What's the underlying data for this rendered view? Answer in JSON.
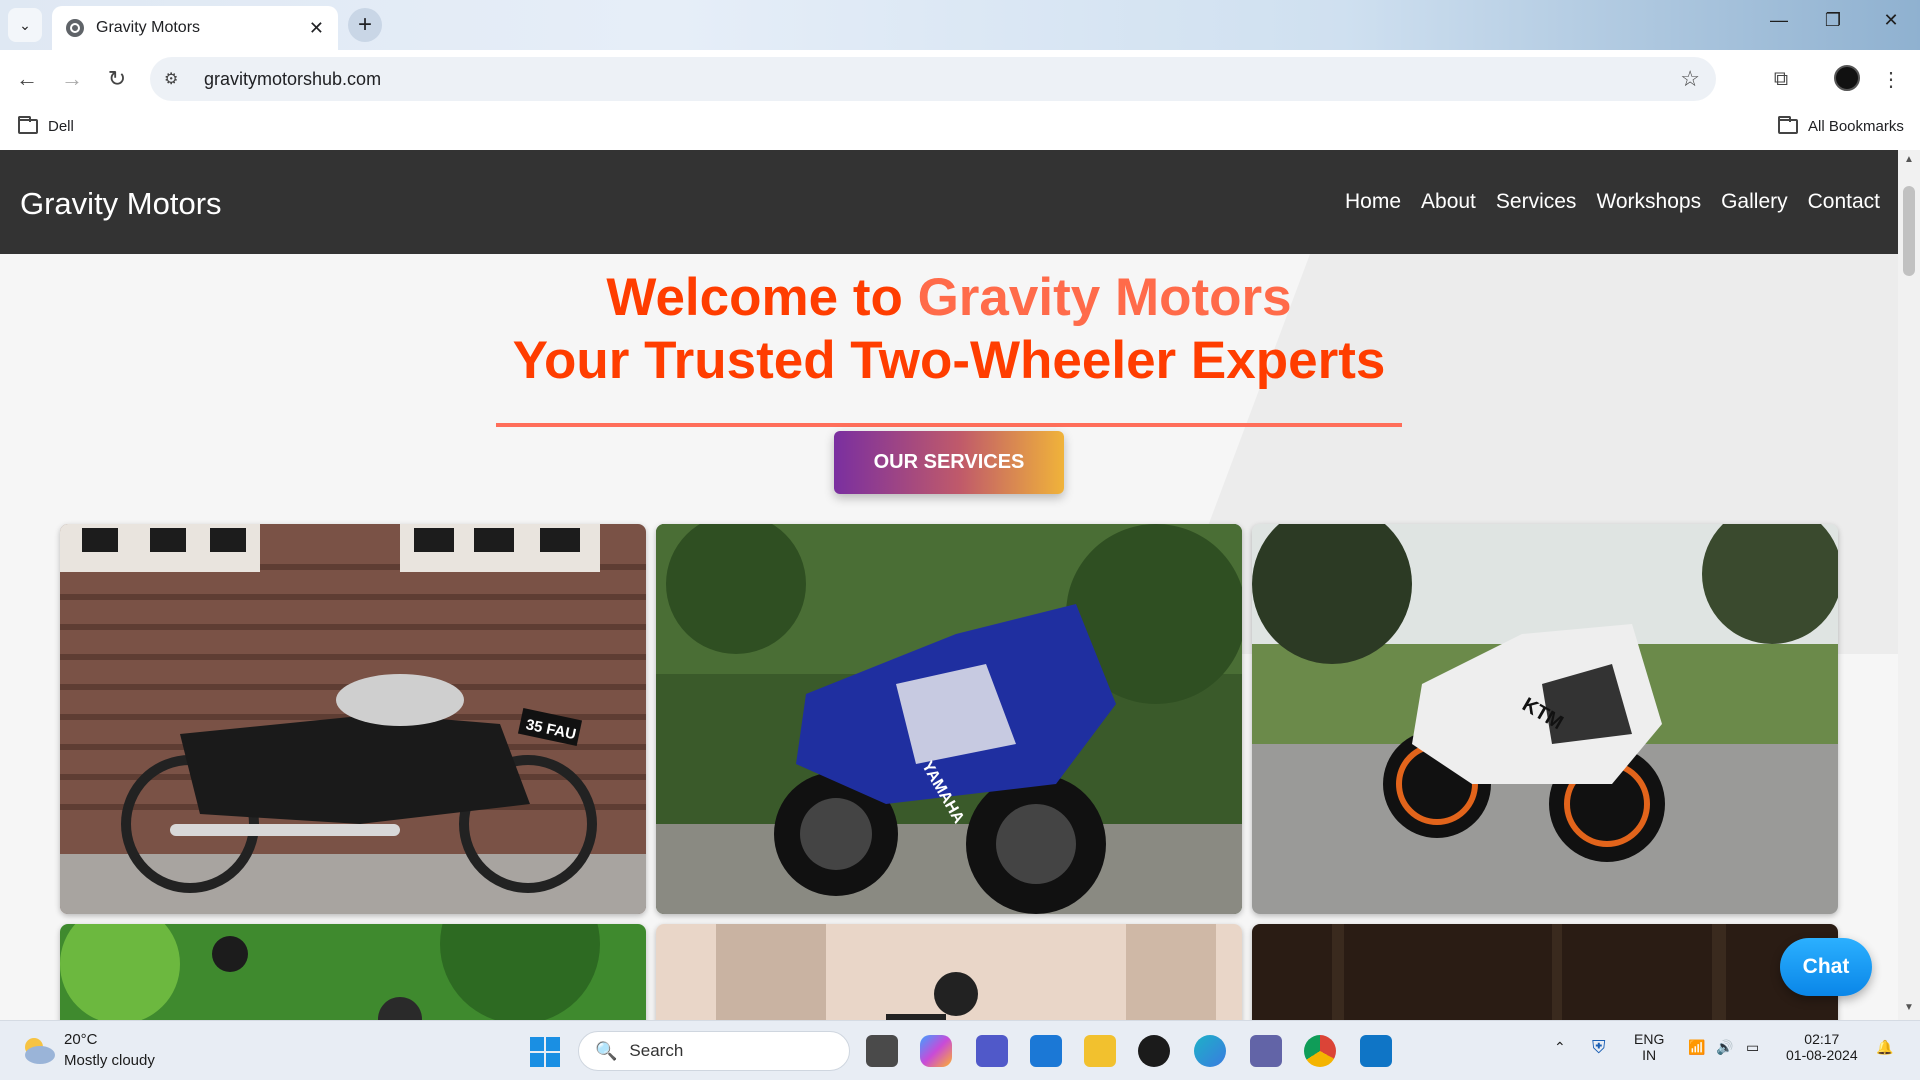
{
  "browser": {
    "tab_title": "Gravity Motors",
    "url": "gravitymotorshub.com",
    "bookmarks": {
      "left": "Dell",
      "right": "All Bookmarks"
    }
  },
  "site": {
    "brand": "Gravity Motors",
    "nav": [
      "Home",
      "About",
      "Services",
      "Workshops",
      "Gallery",
      "Contact"
    ],
    "headline_line1_prefix": "Welcome to ",
    "headline_line1_accent": "Gravity Motors",
    "headline_line2": "Your Trusted Two-Wheeler Experts",
    "cta": "OUR SERVICES",
    "chat": "Chat",
    "gallery": [
      {
        "subject": "vintage motorcycle",
        "plate": "35 FAU"
      },
      {
        "subject": "blue sport motorcycle",
        "brand_text": "YAMAHA"
      },
      {
        "subject": "white and orange sport motorcycle",
        "brand_text": "KTM"
      },
      {
        "subject": "motorcycle in greenery"
      },
      {
        "subject": "motorcycle in city"
      },
      {
        "subject": "dark scene"
      }
    ]
  },
  "taskbar": {
    "weather_temp": "20°C",
    "weather_desc": "Mostly cloudy",
    "search": "Search",
    "lang1": "ENG",
    "lang2": "IN",
    "time": "02:17",
    "date": "01-08-2024"
  }
}
